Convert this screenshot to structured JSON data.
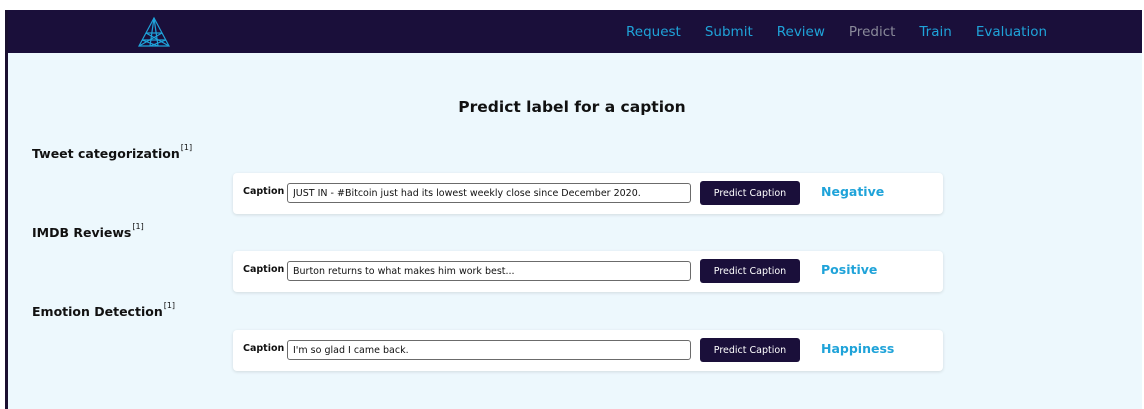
{
  "navbar": {
    "logo_icon": "triangle-mesh-logo-icon",
    "links": [
      {
        "label": "Request",
        "active": false
      },
      {
        "label": "Submit",
        "active": false
      },
      {
        "label": "Review",
        "active": false
      },
      {
        "label": "Predict",
        "active": true
      },
      {
        "label": "Train",
        "active": false
      },
      {
        "label": "Evaluation",
        "active": false
      }
    ]
  },
  "page": {
    "title": "Predict label for a caption"
  },
  "sections": [
    {
      "label": "Tweet categorization",
      "note_marker": "[1]",
      "caption_label": "Caption",
      "caption_value": "JUST IN - #Bitcoin just had its lowest weekly close since December 2020.",
      "button_label": "Predict Caption",
      "result": "Negative"
    },
    {
      "label": "IMDB Reviews",
      "note_marker": "[1]",
      "caption_label": "Caption",
      "caption_value": "Burton returns to what makes him work best...",
      "button_label": "Predict Caption",
      "result": "Positive"
    },
    {
      "label": "Emotion Detection",
      "note_marker": "[1]",
      "caption_label": "Caption",
      "caption_value": "I'm so glad I came back.",
      "button_label": "Predict Caption",
      "result": "Happiness"
    }
  ],
  "colors": {
    "navbar_bg": "#1a0f3a",
    "nav_link": "#1fa3d9",
    "nav_link_active": "#8a8a9a",
    "page_bg": "#edf8fd",
    "result_text": "#1fa3d9",
    "button_bg": "#1a0f3a"
  }
}
